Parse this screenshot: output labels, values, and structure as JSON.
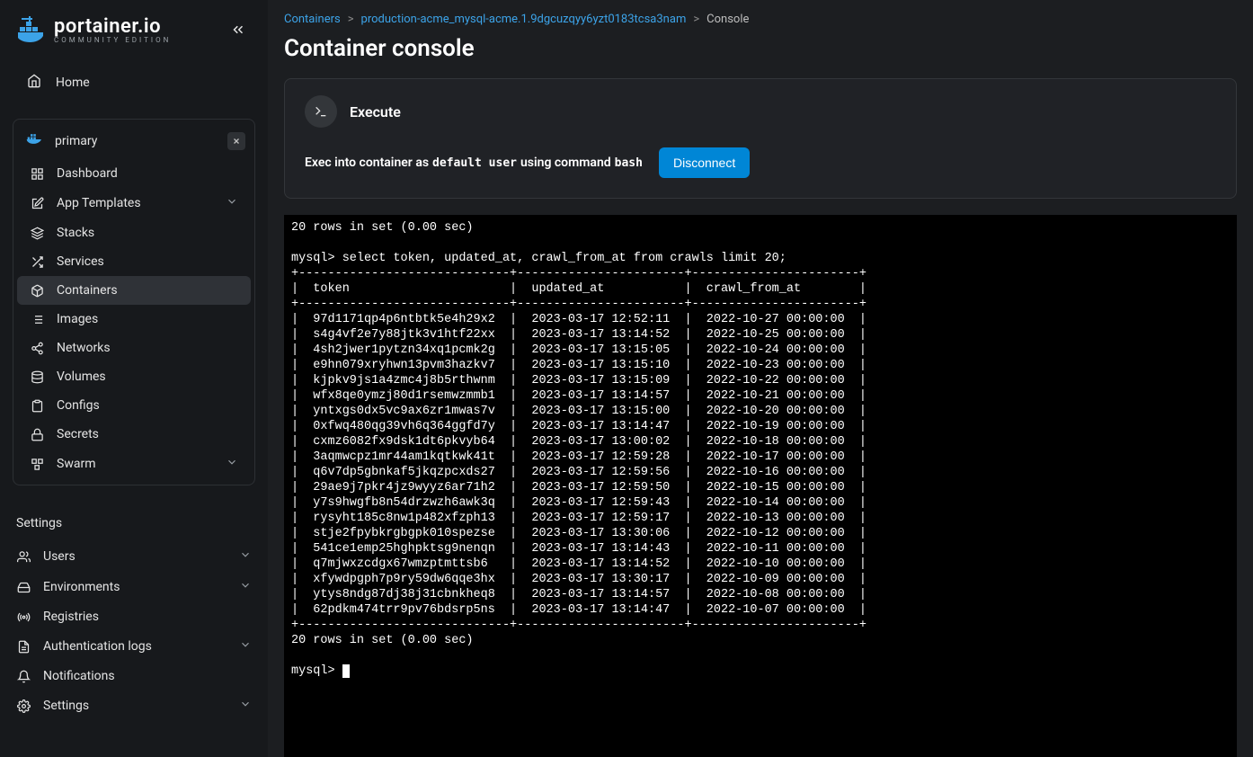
{
  "brand": {
    "name": "portainer.io",
    "edition": "COMMUNITY EDITION"
  },
  "home": {
    "label": "Home"
  },
  "environment": {
    "name": "primary",
    "items": [
      {
        "label": "Dashboard",
        "icon": "grid-icon",
        "chevron": false,
        "active": false
      },
      {
        "label": "App Templates",
        "icon": "edit-icon",
        "chevron": true,
        "active": false
      },
      {
        "label": "Stacks",
        "icon": "layers-icon",
        "chevron": false,
        "active": false
      },
      {
        "label": "Services",
        "icon": "shuffle-icon",
        "chevron": false,
        "active": false
      },
      {
        "label": "Containers",
        "icon": "box-icon",
        "chevron": false,
        "active": true
      },
      {
        "label": "Images",
        "icon": "list-icon",
        "chevron": false,
        "active": false
      },
      {
        "label": "Networks",
        "icon": "share-icon",
        "chevron": false,
        "active": false
      },
      {
        "label": "Volumes",
        "icon": "database-icon",
        "chevron": false,
        "active": false
      },
      {
        "label": "Configs",
        "icon": "clipboard-icon",
        "chevron": false,
        "active": false
      },
      {
        "label": "Secrets",
        "icon": "lock-icon",
        "chevron": false,
        "active": false
      },
      {
        "label": "Swarm",
        "icon": "swarm-icon",
        "chevron": true,
        "active": false
      }
    ]
  },
  "settings": {
    "header": "Settings",
    "items": [
      {
        "label": "Users",
        "icon": "users-icon",
        "chevron": true
      },
      {
        "label": "Environments",
        "icon": "hdd-icon",
        "chevron": true
      },
      {
        "label": "Registries",
        "icon": "radio-icon",
        "chevron": false
      },
      {
        "label": "Authentication logs",
        "icon": "file-icon",
        "chevron": true
      },
      {
        "label": "Notifications",
        "icon": "bell-icon",
        "chevron": false
      },
      {
        "label": "Settings",
        "icon": "gear-icon",
        "chevron": true
      }
    ]
  },
  "breadcrumb": {
    "a": "Containers",
    "b": "production-acme_mysql-acme.1.9dgcuzqyy6yzt0183tcsa3nam",
    "c": "Console"
  },
  "page": {
    "title": "Container console"
  },
  "card": {
    "title": "Execute",
    "text1": "Exec into container as",
    "user": "default user",
    "text2": "using command",
    "cmd": "bash",
    "disconnect": "Disconnect"
  },
  "terminal": {
    "pre_line": "20 rows in set (0.00 sec)",
    "prompt1": "mysql> ",
    "query": "select token, updated_at, crawl_from_at from crawls limit 20;",
    "headers": [
      "token",
      "updated_at",
      "crawl_from_at"
    ],
    "rows": [
      [
        "97d1171qp4p6ntbtk5e4h29x2",
        "2023-03-17 12:52:11",
        "2022-10-27 00:00:00"
      ],
      [
        "s4g4vf2e7y88jtk3v1htf22xx",
        "2023-03-17 13:14:52",
        "2022-10-25 00:00:00"
      ],
      [
        "4sh2jwer1pytzn34xq1pcmk2g",
        "2023-03-17 13:15:05",
        "2022-10-24 00:00:00"
      ],
      [
        "e9hn079xryhwn13pvm3hazkv7",
        "2023-03-17 13:15:10",
        "2022-10-23 00:00:00"
      ],
      [
        "kjpkv9js1a4zmc4j8b5rthwnm",
        "2023-03-17 13:15:09",
        "2022-10-22 00:00:00"
      ],
      [
        "wfx8qe0ymzj80d1rsemwzmmb1",
        "2023-03-17 13:14:57",
        "2022-10-21 00:00:00"
      ],
      [
        "yntxgs0dx5vc9ax6zr1mwas7v",
        "2023-03-17 13:15:00",
        "2022-10-20 00:00:00"
      ],
      [
        "0xfwq480qg39vh6q364ggfd7y",
        "2023-03-17 13:14:47",
        "2022-10-19 00:00:00"
      ],
      [
        "cxmz6082fx9dsk1dt6pkvyb64",
        "2023-03-17 13:00:02",
        "2022-10-18 00:00:00"
      ],
      [
        "3aqmwcpz1mr44am1kqtkwk41t",
        "2023-03-17 12:59:28",
        "2022-10-17 00:00:00"
      ],
      [
        "q6v7dp5gbnkaf5jkqzpcxds27",
        "2023-03-17 12:59:56",
        "2022-10-16 00:00:00"
      ],
      [
        "29ae9j7pkr4jz9wyyz6ar71h2",
        "2023-03-17 12:59:50",
        "2022-10-15 00:00:00"
      ],
      [
        "y7s9hwgfb8n54drzwzh6awk3q",
        "2023-03-17 12:59:43",
        "2022-10-14 00:00:00"
      ],
      [
        "rysyht185c8nw1p482xfzph13",
        "2023-03-17 12:59:17",
        "2022-10-13 00:00:00"
      ],
      [
        "stje2fpybkrgbgpk010spezse",
        "2023-03-17 13:30:06",
        "2022-10-12 00:00:00"
      ],
      [
        "541ce1emp25hghpktsg9nenqn",
        "2023-03-17 13:14:43",
        "2022-10-11 00:00:00"
      ],
      [
        "q7mjwxzcdgx67wmzptmttsb6 ",
        "2023-03-17 13:14:52",
        "2022-10-10 00:00:00"
      ],
      [
        "xfywdpgph7p9ry59dw6qqe3hx",
        "2023-03-17 13:30:17",
        "2022-10-09 00:00:00"
      ],
      [
        "ytys8ndg87dj38j31cbnkheq8",
        "2023-03-17 13:14:57",
        "2022-10-08 00:00:00"
      ],
      [
        "62pdkm474trr9pv76bdsrp5ns",
        "2023-03-17 13:14:47",
        "2022-10-07 00:00:00"
      ]
    ],
    "post_line": "20 rows in set (0.00 sec)",
    "prompt2": "mysql> "
  }
}
